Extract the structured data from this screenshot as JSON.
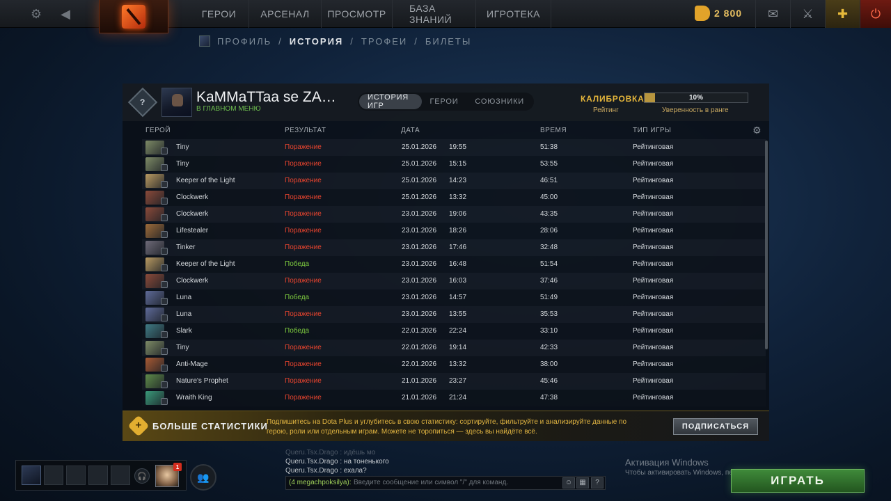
{
  "topbar": {
    "nav": [
      "ГЕРОИ",
      "АРСЕНАЛ",
      "ПРОСМОТР",
      "БАЗА ЗНАНИЙ",
      "ИГРОТЕКА"
    ],
    "gold": "2 800",
    "icons": [
      "gear-icon",
      "back-arrow-icon",
      "dota-logo-icon",
      "mail-icon",
      "armory-icon",
      "dota-plus-icon",
      "power-icon"
    ]
  },
  "subnav": {
    "items": [
      "ПРОФИЛЬ",
      "ИСТОРИЯ",
      "ТРОФЕИ",
      "БИЛЕТЫ"
    ],
    "separator": "/",
    "active": "ИСТОРИЯ"
  },
  "profile": {
    "name": "KaMMaTTaa se ZA…",
    "status": "В ГЛАВНОМ МЕНЮ",
    "tabs": [
      "ИСТОРИЯ ИГР",
      "ГЕРОИ",
      "СОЮЗНИКИ"
    ],
    "calibration_label": "КАЛИБРОВКА",
    "rating_label": "Рейтинг",
    "confidence_value": "10%",
    "confidence_fraction": 0.1,
    "confidence_label": "Уверенность в ранге"
  },
  "table": {
    "headers": [
      "ГЕРОЙ",
      "РЕЗУЛЬТАТ",
      "ДАТА",
      "ВРЕМЯ",
      "ТИП ИГРЫ"
    ],
    "rows": [
      {
        "hero": "Tiny",
        "result": "Поражение",
        "win": false,
        "date": "25.01.2026",
        "clock": "19:55",
        "duration": "51:38",
        "type": "Рейтинговая",
        "color": "#7d8a66"
      },
      {
        "hero": "Tiny",
        "result": "Поражение",
        "win": false,
        "date": "25.01.2026",
        "clock": "15:15",
        "duration": "53:55",
        "type": "Рейтинговая",
        "color": "#7d8a66"
      },
      {
        "hero": "Keeper of the Light",
        "result": "Поражение",
        "win": false,
        "date": "25.01.2026",
        "clock": "14:23",
        "duration": "46:51",
        "type": "Рейтинговая",
        "color": "#b89a62"
      },
      {
        "hero": "Clockwerk",
        "result": "Поражение",
        "win": false,
        "date": "25.01.2026",
        "clock": "13:32",
        "duration": "45:00",
        "type": "Рейтинговая",
        "color": "#8a4a3a"
      },
      {
        "hero": "Clockwerk",
        "result": "Поражение",
        "win": false,
        "date": "23.01.2026",
        "clock": "19:06",
        "duration": "43:35",
        "type": "Рейтинговая",
        "color": "#8a4a3a"
      },
      {
        "hero": "Lifestealer",
        "result": "Поражение",
        "win": false,
        "date": "23.01.2026",
        "clock": "18:26",
        "duration": "28:06",
        "type": "Рейтинговая",
        "color": "#9c6a3a"
      },
      {
        "hero": "Tinker",
        "result": "Поражение",
        "win": false,
        "date": "23.01.2026",
        "clock": "17:46",
        "duration": "32:48",
        "type": "Рейтинговая",
        "color": "#6e6a78"
      },
      {
        "hero": "Keeper of the Light",
        "result": "Победа",
        "win": true,
        "date": "23.01.2026",
        "clock": "16:48",
        "duration": "51:54",
        "type": "Рейтинговая",
        "color": "#b89a62"
      },
      {
        "hero": "Clockwerk",
        "result": "Поражение",
        "win": false,
        "date": "23.01.2026",
        "clock": "16:03",
        "duration": "37:46",
        "type": "Рейтинговая",
        "color": "#8a4a3a"
      },
      {
        "hero": "Luna",
        "result": "Победа",
        "win": true,
        "date": "23.01.2026",
        "clock": "14:57",
        "duration": "51:49",
        "type": "Рейтинговая",
        "color": "#5e6a98"
      },
      {
        "hero": "Luna",
        "result": "Поражение",
        "win": false,
        "date": "23.01.2026",
        "clock": "13:55",
        "duration": "35:53",
        "type": "Рейтинговая",
        "color": "#5e6a98"
      },
      {
        "hero": "Slark",
        "result": "Победа",
        "win": true,
        "date": "22.01.2026",
        "clock": "22:24",
        "duration": "33:10",
        "type": "Рейтинговая",
        "color": "#3f7a84"
      },
      {
        "hero": "Tiny",
        "result": "Поражение",
        "win": false,
        "date": "22.01.2026",
        "clock": "19:14",
        "duration": "42:33",
        "type": "Рейтинговая",
        "color": "#7d8a66"
      },
      {
        "hero": "Anti-Mage",
        "result": "Поражение",
        "win": false,
        "date": "22.01.2026",
        "clock": "13:32",
        "duration": "38:00",
        "type": "Рейтинговая",
        "color": "#a85a34"
      },
      {
        "hero": "Nature's Prophet",
        "result": "Поражение",
        "win": false,
        "date": "21.01.2026",
        "clock": "23:27",
        "duration": "45:46",
        "type": "Рейтинговая",
        "color": "#5e8a4a"
      },
      {
        "hero": "Wraith King",
        "result": "Поражение",
        "win": false,
        "date": "21.01.2026",
        "clock": "21:24",
        "duration": "47:38",
        "type": "Рейтинговая",
        "color": "#3a9a7a"
      }
    ]
  },
  "promo": {
    "title": "БОЛЬШЕ СТАТИСТИКИ",
    "text": "Подпишитесь на Dota Plus и углубитесь в свою статистику: сортируйте, фильтруйте и анализируйте данные по герою, роли или отдельным играм. Можете не торопиться — здесь вы найдёте всё.",
    "button": "ПОДПИСАТЬСЯ"
  },
  "chat": {
    "lines": [
      {
        "who": "Queru.Tsx.Drago",
        "msg": ": идёшь мо"
      },
      {
        "who": "Queru.Tsx.Drago",
        "msg": ": на тоненького"
      },
      {
        "who": "Queru.Tsx.Drago",
        "msg": ": ехала?"
      }
    ],
    "channel": "(4 megachpoksilya):",
    "placeholder": "Введите сообщение или символ \"/\" для команд.",
    "help": "?"
  },
  "notifications": {
    "count": "1"
  },
  "windows": {
    "line1": "Активация Windows",
    "line2": "Чтобы активировать Windows, перейдите в раздел \"Параметры\"."
  },
  "play_button": "ИГРАТЬ"
}
